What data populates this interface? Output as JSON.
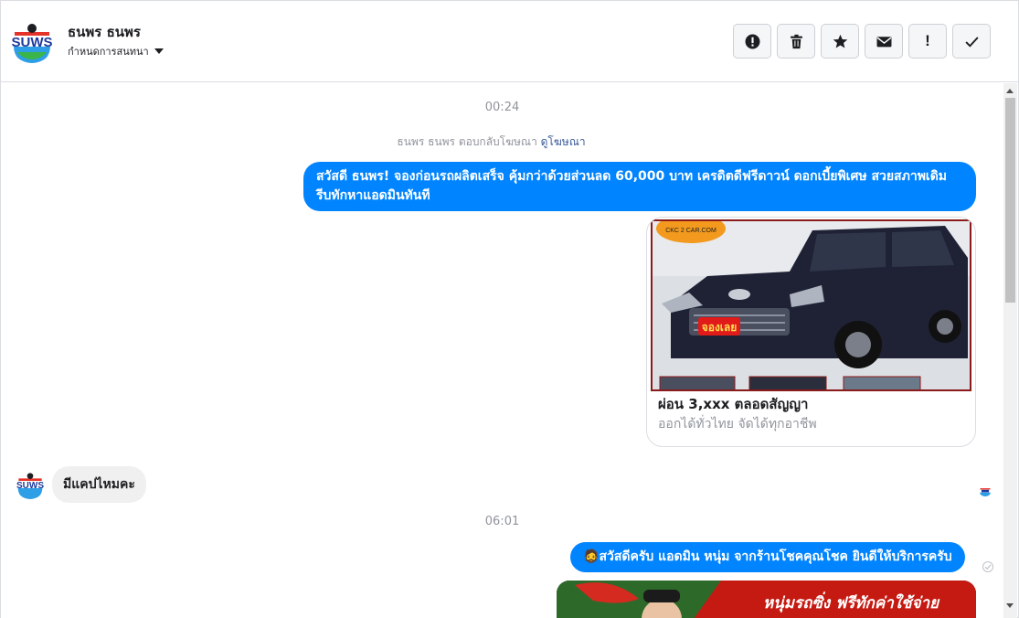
{
  "header": {
    "contact_name": "ธนพร ธนพร",
    "conversation_label": "กำหนดการสนทนา",
    "avatar_brand": "SUWS",
    "actions": [
      {
        "name": "spam-button",
        "icon": "alert-circle-icon"
      },
      {
        "name": "delete-button",
        "icon": "trash-icon"
      },
      {
        "name": "star-button",
        "icon": "star-icon"
      },
      {
        "name": "mark-unread-button",
        "icon": "envelope-icon"
      },
      {
        "name": "follow-up-button",
        "label": "!"
      },
      {
        "name": "done-button",
        "icon": "checkmark-icon"
      }
    ]
  },
  "thread": {
    "time_1": "00:24",
    "ad_reply_text": "ธนพร ธนพร ตอบกลับโฆษณา",
    "ad_reply_link": "ดูโฆษณา",
    "message_out_1": "สวัสดี ธนพร! จองก่อนรถผลิตเสร็จ คุ้มกว่าด้วยส่วนลด 60,000 บาท เครดิตดีฟรีดาวน์ ดอกเบี้ยพิเศษ สวยสภาพเดิม รีบทักหาแอดมินทันที",
    "card": {
      "image_caption_top": "CKC 2 CAR.COM",
      "image_badge": "จองเลย",
      "title": "ผ่อน 3,xxx ตลอดสัญญา",
      "subtitle": "ออกได้ทั่วไทย จัดได้ทุกอาชีพ"
    },
    "message_in_1": "มีแคปไหมคะ",
    "time_2": "06:01",
    "message_out_2_emoji": "🧔",
    "message_out_2": "สวัสดีครับ แอดมิน หนุ่ม จากร้านโชคคุณโชค ยินดีให้บริการครับ",
    "banner_text": "หนุ่มรถซิ่ง ฟรีทักค่าใช้จ่าย"
  },
  "colors": {
    "outgoing_bubble": "#0084ff",
    "incoming_bubble": "#f1f0f0",
    "link": "#385898",
    "muted_text": "#90949c"
  }
}
